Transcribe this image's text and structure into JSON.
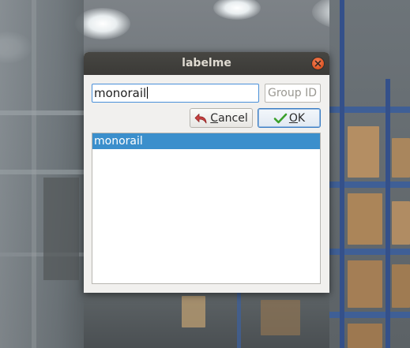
{
  "window": {
    "title": "labelme"
  },
  "form": {
    "label_value": "monorail",
    "group_id_placeholder": "Group ID"
  },
  "buttons": {
    "cancel_label": "Cancel",
    "ok_label": "OK"
  },
  "label_list": {
    "items": [
      "monorail"
    ],
    "selected_index": 0
  },
  "colors": {
    "titlebar": "#3b3a37",
    "close_button": "#e15a29",
    "focus_border": "#4a90d9",
    "selection": "#3b8fcc",
    "dialog_background": "#f1f0ee"
  },
  "icons": {
    "close": "close-icon",
    "cancel": "undo-arrow-icon",
    "ok": "checkmark-icon"
  }
}
